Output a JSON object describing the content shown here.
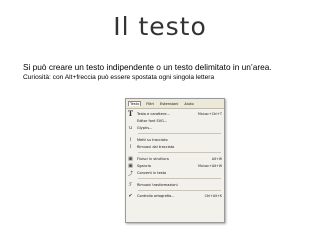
{
  "slide": {
    "title": "Il testo",
    "line1": "Si può creare un testo indipendente o un testo delimitato in un’area.",
    "line2": "Curiosità: con Alt+freccia può essere spostata ogni singola lettera"
  },
  "menu_screenshot": {
    "menubar": [
      "Testo",
      "Filtri",
      "Estensioni",
      "Aiuto"
    ],
    "items": [
      {
        "icon": "T",
        "label": "Testo e carattere...",
        "shortcut": "Maiusc+Ctrl+T"
      },
      {
        "icon": "",
        "label": "Editor font SVG...",
        "shortcut": ""
      },
      {
        "icon": "ꭒ",
        "label": "Glyphs...",
        "shortcut": ""
      },
      {
        "sep": true
      },
      {
        "icon": "⌇",
        "label": "Metti su tracciato",
        "shortcut": ""
      },
      {
        "icon": "⌇",
        "label": "Rimuovi dal tracciato",
        "shortcut": ""
      },
      {
        "sep": true
      },
      {
        "icon": "▣",
        "label": "Fluisci in struttura",
        "shortcut": "Alt+W"
      },
      {
        "icon": "▣",
        "label": "Sgancia",
        "shortcut": "Maiusc+Alt+W"
      },
      {
        "icon": "⤴",
        "label": "Converti in testo",
        "shortcut": ""
      },
      {
        "sep": true
      },
      {
        "icon": "ℱ",
        "label": "Rimuovi trasformazioni",
        "shortcut": ""
      },
      {
        "sep": true
      },
      {
        "icon": "✔",
        "label": "Controllo ortografia...",
        "shortcut": "Ctrl+Alt+K"
      }
    ]
  }
}
